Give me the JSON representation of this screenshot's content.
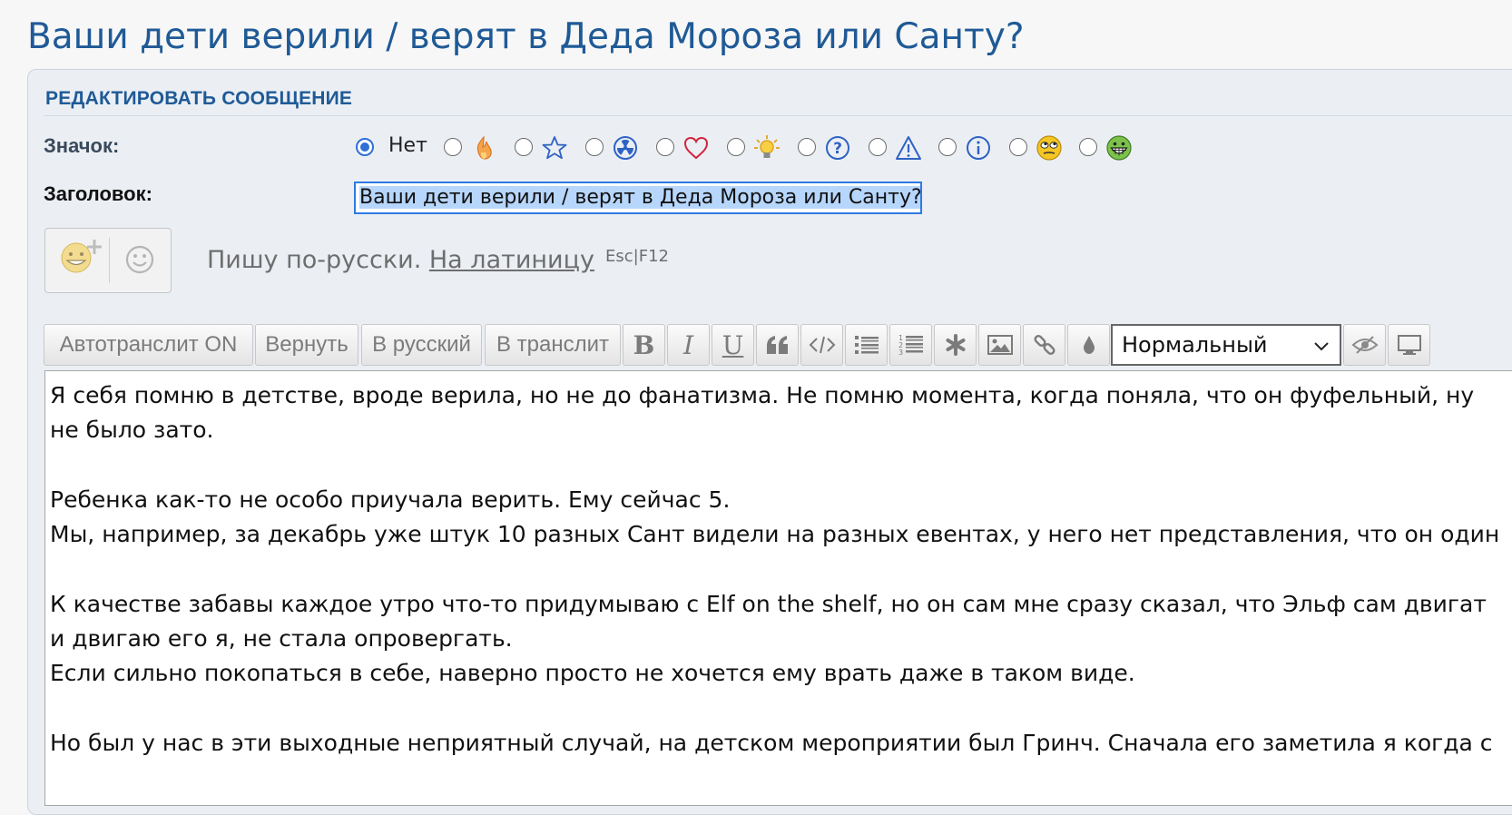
{
  "page": {
    "title": "Ваши дети верили / верят в Деда Мороза или Санту?"
  },
  "form": {
    "header": "РЕДАКТИРОВАТЬ СООБЩЕНИЕ",
    "icon_label": "Значок:",
    "icon_none_label": "Нет",
    "selected_icon": "none",
    "icon_options": [
      "none",
      "fire-icon",
      "star-icon",
      "radioactive-icon",
      "heart-icon",
      "lightbulb-icon",
      "question-icon",
      "warning-icon",
      "info-icon",
      "eye-roll-emoji-icon",
      "grin-emoji-icon"
    ],
    "title_label": "Заголовок:",
    "title_value": "Ваши дети верили / верят в Деда Мороза или Санту?"
  },
  "translit": {
    "message": "Пишу по-русски.",
    "link": "На латиницу",
    "hotkey": "Esc|F12"
  },
  "toolbar": {
    "autotranslit": "Автотранслит ON",
    "revert": "Вернуть",
    "to_russian": "В русский",
    "to_translit": "В транслит",
    "bold": "B",
    "italic": "I",
    "underline": "U",
    "size_selected": "Нормальный"
  },
  "editor": {
    "lines": [
      "Я себя помню в детстве, вроде верила, но не до фанатизма. Не помню момента, когда поняла, что он фуфельный, ну",
      "не было зато.",
      "",
      "Ребенка как-то не особо приучала верить. Ему сейчас 5.",
      "Мы, например, за декабрь уже штук 10 разных Сант видели на разных евентах, у него нет представления, что он один",
      "",
      "К качестве забавы каждое утро что-то придумываю с Elf on the shelf, но он сам мне сразу сказал, что Эльф сам двигат",
      "и двигаю его я, не стала опровергать.",
      "Если сильно покопаться в себе, наверно просто не хочется ему врать даже в таком виде.",
      "",
      "Но был у нас в эти выходные неприятный случай, на детском мероприятии был Гринч. Сначала его заметила я когда с"
    ]
  }
}
